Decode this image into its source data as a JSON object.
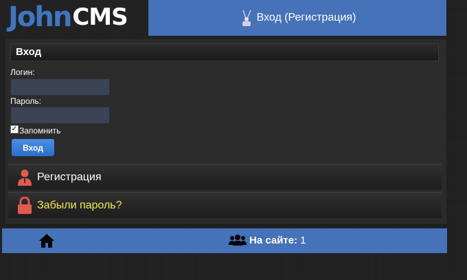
{
  "header": {
    "logo_primary": "John",
    "logo_secondary": "CMS",
    "login_link": "Вход (Регистрация)"
  },
  "login": {
    "title": "Вход",
    "username_label": "Логин:",
    "username_value": "",
    "password_label": "Пароль:",
    "password_value": "",
    "remember_label": "Запомнить",
    "remember_checked": true,
    "submit_label": "Вход"
  },
  "menu": {
    "register_label": "Регистрация",
    "forgot_label": "Забыли пароль?"
  },
  "footer": {
    "online_label": "На сайте:",
    "online_count": "1"
  },
  "icons": [
    "home-icon",
    "users-icon",
    "user-icon",
    "lock-icon",
    "antenna-icon"
  ],
  "colors": {
    "accent": "#4572b8",
    "link_highlight": "#f4e94e",
    "icon_red": "#e05a4f"
  }
}
